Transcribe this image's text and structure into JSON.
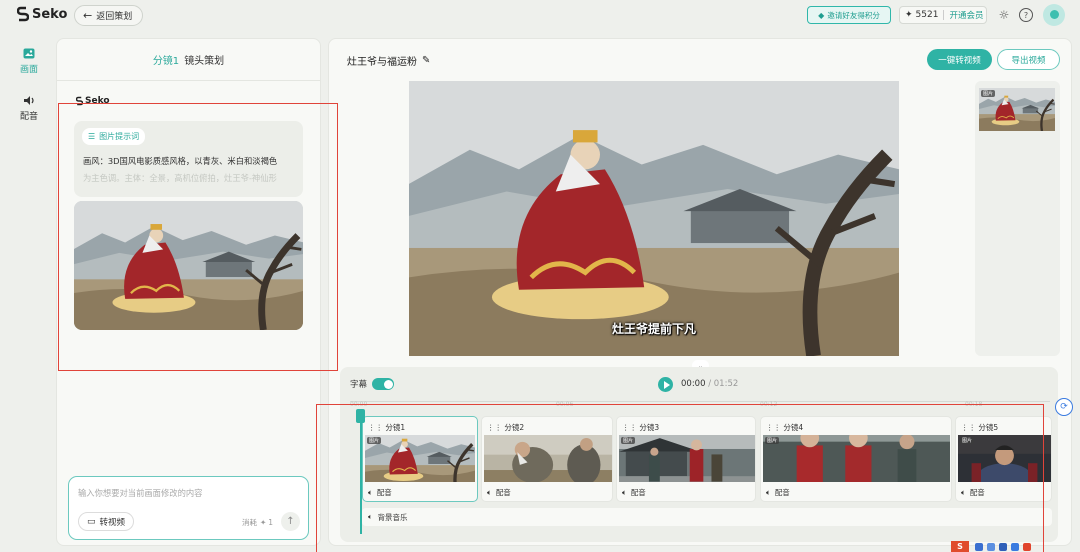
{
  "header": {
    "logo_text": "Seko",
    "back_label": "返回策划",
    "invite_label": "邀请好友得积分",
    "credits": "5521",
    "vip_label": "开通会员"
  },
  "nav": [
    {
      "label": "画面",
      "icon": "image-icon",
      "active": true
    },
    {
      "label": "配音",
      "icon": "speaker-icon",
      "active": false
    }
  ],
  "left_panel": {
    "shot_num": "分镜1",
    "title": "镜头策划",
    "brand_text": "Seko",
    "prompt_tag": "图片提示词",
    "prompt_line1": "画风：3D国风电影质感风格，以青灰、米白和淡褐色",
    "prompt_line2": "为主色调。主体：全景，高机位俯拍，灶王爷-神仙形",
    "input_placeholder": "输入你想要对当前画面修改的内容",
    "to_video_label": "转视频",
    "cost_label": "消耗",
    "cost_value": "1"
  },
  "main": {
    "title": "灶王爷与福运粉",
    "convert_label": "一键转视频",
    "export_label": "导出视频",
    "subtitle": "灶王爷提前下凡",
    "thumb_badge": "图片"
  },
  "timeline": {
    "subtitle_label": "字幕",
    "current_time": "00:00",
    "total_time": "/ 01:52",
    "ruler": [
      "00:00",
      "00:06",
      "00:12",
      "00:18"
    ],
    "clips": [
      {
        "name": "分镜1",
        "dub": "配音",
        "badge": "图片"
      },
      {
        "name": "分镜2",
        "dub": "配音",
        "badge": "图片"
      },
      {
        "name": "分镜3",
        "dub": "配音",
        "badge": "图片"
      },
      {
        "name": "分镜4",
        "dub": "配音",
        "badge": "图片"
      },
      {
        "name": "分镜5",
        "dub": "配音",
        "badge": "图片"
      }
    ],
    "bgm_label": "背景音乐"
  },
  "colors": {
    "accent": "#2fb3a5",
    "highlight": "#e0443a"
  }
}
